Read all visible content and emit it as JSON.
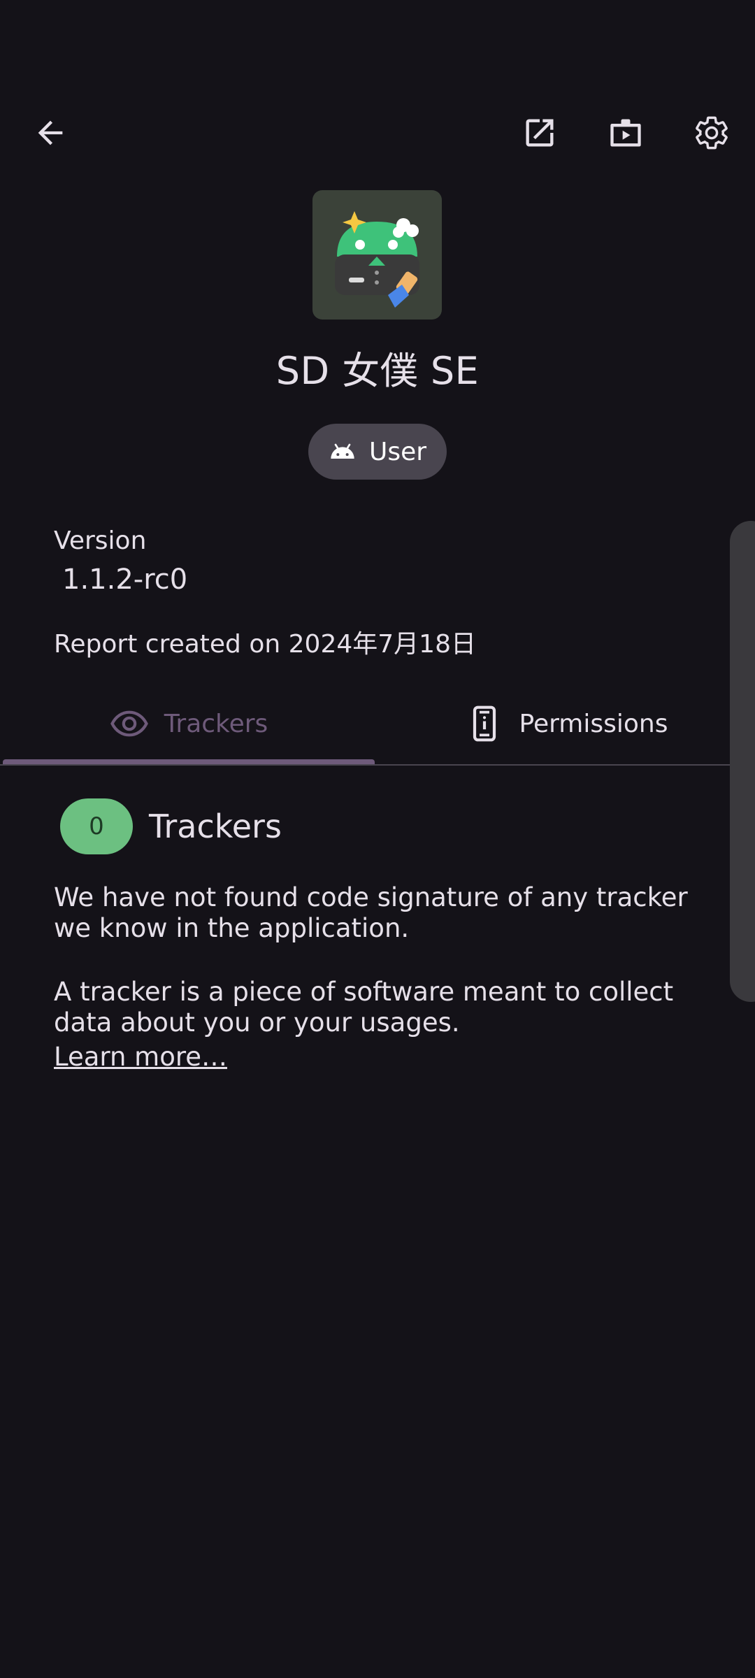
{
  "toolbar": {
    "back_icon": "arrow-left-icon",
    "actions": [
      "open-external-icon",
      "store-launch-icon",
      "settings-gear-icon"
    ]
  },
  "app": {
    "name": "SD 女僕 SE",
    "icon": "sd-maid-app-icon",
    "type_chip": {
      "icon": "android-icon",
      "label": "User"
    },
    "version_label": "Version",
    "version_value": "1.1.2-rc0",
    "report_date": "Report created on 2024年7月18日"
  },
  "tabs": [
    {
      "label": "Trackers",
      "icon": "eye-icon",
      "selected": true
    },
    {
      "label": "Permissions",
      "icon": "phone-info-icon",
      "selected": false
    }
  ],
  "trackers_section": {
    "count": "0",
    "heading": "Trackers",
    "paragraph1": "We have not found code signature of any tracker we know in the application.",
    "paragraph2": "A tracker is a piece of software meant to collect data about you or your usages.",
    "learn_more": "Learn more…"
  },
  "colors": {
    "background": "#141218",
    "accent": "#6e5a7a",
    "badge": "#6cc081",
    "chip": "#49454f"
  }
}
